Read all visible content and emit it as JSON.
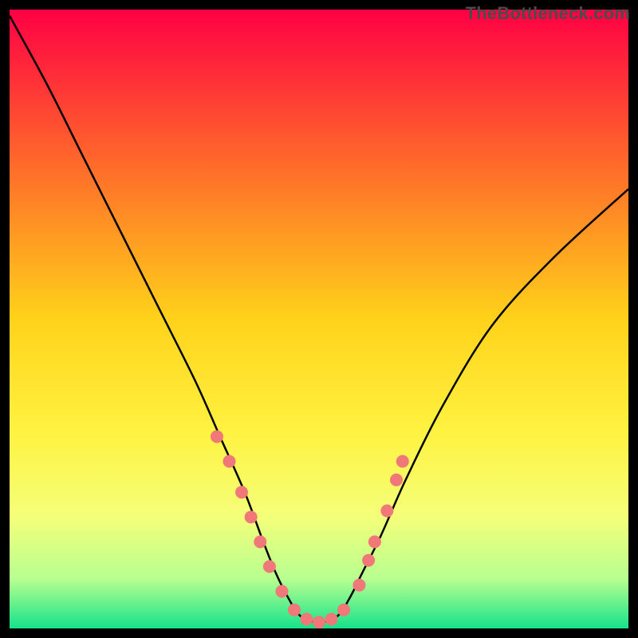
{
  "watermark": "TheBottleneck.com",
  "chart_data": {
    "type": "line",
    "title": "",
    "xlabel": "",
    "ylabel": "",
    "xlim": [
      0,
      100
    ],
    "ylim": [
      0,
      100
    ],
    "gradient_stops": [
      {
        "offset": 0.0,
        "color": "#ff0044"
      },
      {
        "offset": 0.25,
        "color": "#ff6a2a"
      },
      {
        "offset": 0.5,
        "color": "#ffd21a"
      },
      {
        "offset": 0.68,
        "color": "#fff240"
      },
      {
        "offset": 0.82,
        "color": "#f4ff7a"
      },
      {
        "offset": 0.92,
        "color": "#b7ff90"
      },
      {
        "offset": 1.0,
        "color": "#15e28a"
      }
    ],
    "series": [
      {
        "name": "curve",
        "x": [
          0,
          6,
          12,
          18,
          24,
          30,
          34,
          38,
          41,
          43,
          45,
          47,
          50,
          53,
          55,
          57,
          60,
          64,
          70,
          78,
          88,
          100
        ],
        "y": [
          99,
          88,
          76,
          64,
          52,
          40,
          31,
          22,
          14,
          9,
          5,
          2,
          1,
          2,
          5,
          9,
          15,
          24,
          36,
          49,
          60,
          71
        ]
      }
    ],
    "markers": [
      {
        "x": 33.5,
        "y": 31
      },
      {
        "x": 35.5,
        "y": 27
      },
      {
        "x": 37.5,
        "y": 22
      },
      {
        "x": 39.0,
        "y": 18
      },
      {
        "x": 40.5,
        "y": 14
      },
      {
        "x": 42.0,
        "y": 10
      },
      {
        "x": 44.0,
        "y": 6
      },
      {
        "x": 46.0,
        "y": 3
      },
      {
        "x": 48.0,
        "y": 1.5
      },
      {
        "x": 50.0,
        "y": 1
      },
      {
        "x": 52.0,
        "y": 1.5
      },
      {
        "x": 54.0,
        "y": 3
      },
      {
        "x": 56.5,
        "y": 7
      },
      {
        "x": 58.0,
        "y": 11
      },
      {
        "x": 59.0,
        "y": 14
      },
      {
        "x": 61.0,
        "y": 19
      },
      {
        "x": 62.5,
        "y": 24
      },
      {
        "x": 63.5,
        "y": 27
      }
    ],
    "marker_color": "#f07878",
    "marker_radius": 8,
    "line_color": "#000000",
    "line_width": 2.5,
    "background": "#000000"
  }
}
